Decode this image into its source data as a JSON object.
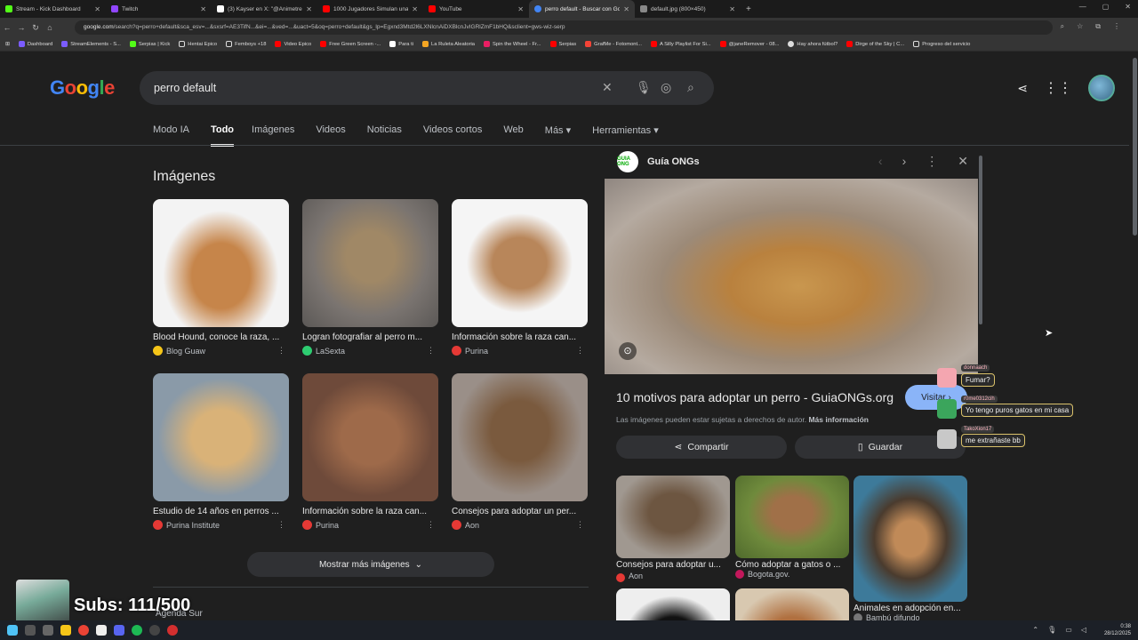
{
  "browser": {
    "tabs": [
      {
        "title": "Stream - Kick Dashboard",
        "color": "#53fc18"
      },
      {
        "title": "Twitch",
        "color": "#9146ff"
      },
      {
        "title": "(3) Kayser en X: \"@Animetrends",
        "color": "#ffffff"
      },
      {
        "title": "1000 Jugadores Simulan una C",
        "color": "#ff0000"
      },
      {
        "title": "YouTube",
        "color": "#ff0000"
      },
      {
        "title": "perro default - Buscar con Goo",
        "color": "#4285f4",
        "active": true
      },
      {
        "title": "default.jpg (800×450)",
        "color": "#888888"
      }
    ],
    "url_domain": "google.com",
    "url_rest": "/search?q=perro+default&sca_esv=...&sxsrf=AE3TifN...&ei=...&ved=...&uact=5&oq=perro+default&gs_lp=Egxnd3Mtd2l6LXNlcnAiDXBlcnJvIGRlZmF1bHQ&sclient=gws-wiz-serp",
    "bookmarks": [
      {
        "label": "Dashboard",
        "color": "#7b5cff"
      },
      {
        "label": "StreamElements - S...",
        "color": "#7b5cff"
      },
      {
        "label": "Serpias | Kick",
        "color": "#53fc18"
      },
      {
        "label": "Hentai Epico",
        "color": "#dddddd"
      },
      {
        "label": "Femboys +18",
        "color": "#dddddd"
      },
      {
        "label": "Video Epico",
        "color": "#ff0000"
      },
      {
        "label": "Free Green Screen -...",
        "color": "#ff0000"
      },
      {
        "label": "Para ti",
        "color": "#ffffff"
      },
      {
        "label": "La Ruleta Aleatoria",
        "color": "#f5a623"
      },
      {
        "label": "Spin the Wheel - Fr...",
        "color": "#e91e63"
      },
      {
        "label": "Serpias",
        "color": "#ff0000"
      },
      {
        "label": "GrafMe - Fotomont...",
        "color": "#f44336"
      },
      {
        "label": "A Silly Playlist For Si...",
        "color": "#ff0000"
      },
      {
        "label": "@janeRemover - 08...",
        "color": "#ff0000"
      },
      {
        "label": "Hay ahora fútbol?",
        "color": "#dddddd"
      },
      {
        "label": "Dirge of the Sky | C...",
        "color": "#ff0000"
      },
      {
        "label": "Progreso del servicio",
        "color": "#dddddd"
      }
    ]
  },
  "google": {
    "logo": "Google",
    "query": "perro default",
    "nav_tabs": [
      "Modo IA",
      "Todo",
      "Imágenes",
      "Videos",
      "Noticias",
      "Videos cortos",
      "Web",
      "Más ▾",
      "Herramientas ▾"
    ],
    "images_heading": "Imágenes",
    "results": [
      {
        "title": "Blood Hound, conoce la raza, ...",
        "source": "Blog Guaw",
        "src_color": "#f5c518",
        "img": "#c6854a"
      },
      {
        "title": "Logran fotografiar al perro m...",
        "source": "LaSexta",
        "src_color": "#2ecc71",
        "img": "#a08866"
      },
      {
        "title": "Información sobre la raza can...",
        "source": "Purina",
        "src_color": "#e53935",
        "img": "#b8865a"
      },
      {
        "title": "Estudio de 14 años en perros ...",
        "source": "Purina Institute",
        "src_color": "#e53935",
        "img": "#d9b278"
      },
      {
        "title": "Información sobre la raza can...",
        "source": "Purina",
        "src_color": "#e53935",
        "img": "#9e6a4a"
      },
      {
        "title": "Consejos para adoptar un per...",
        "source": "Aon",
        "src_color": "#e53935",
        "img": "#7a5a3e"
      }
    ],
    "more_images": "Mostrar más imágenes",
    "agenda": "Agenda Sur"
  },
  "panel": {
    "site": "Guía ONGs",
    "logo_text": "GUIA ONG",
    "title": "10 motivos para adoptar un perro - GuiaONGs.org",
    "visit": "Visitar  ›",
    "note": "Las imágenes pueden estar sujetas a derechos de autor.",
    "note_link": "Más información",
    "share": "Compartir",
    "save": "Guardar",
    "related": [
      {
        "title": "Consejos para adoptar u...",
        "source": "Aon",
        "src_color": "#e53935",
        "img": "#6d5641"
      },
      {
        "title": "Cómo adoptar a gatos o ...",
        "source": "Bogota.gov.",
        "src_color": "#c2185b",
        "img": "#6f8a3c"
      },
      {
        "title": "Animales en adopción en...",
        "source": "Bambú difundo",
        "src_color": "#777777",
        "img": "#4a3b2e"
      }
    ]
  },
  "stream_overlay": {
    "chat": [
      {
        "user": "donnaach",
        "msg": "Fumar?"
      },
      {
        "user": "r0me0312cih",
        "msg": "Yo tengo puros gatos en mi casa"
      },
      {
        "user": "TakoXion17",
        "msg": "me extrañaste bb"
      }
    ],
    "subs": "Subs: 111/500"
  },
  "taskbar": {
    "time": "0:38",
    "date": "28/12/2025"
  }
}
